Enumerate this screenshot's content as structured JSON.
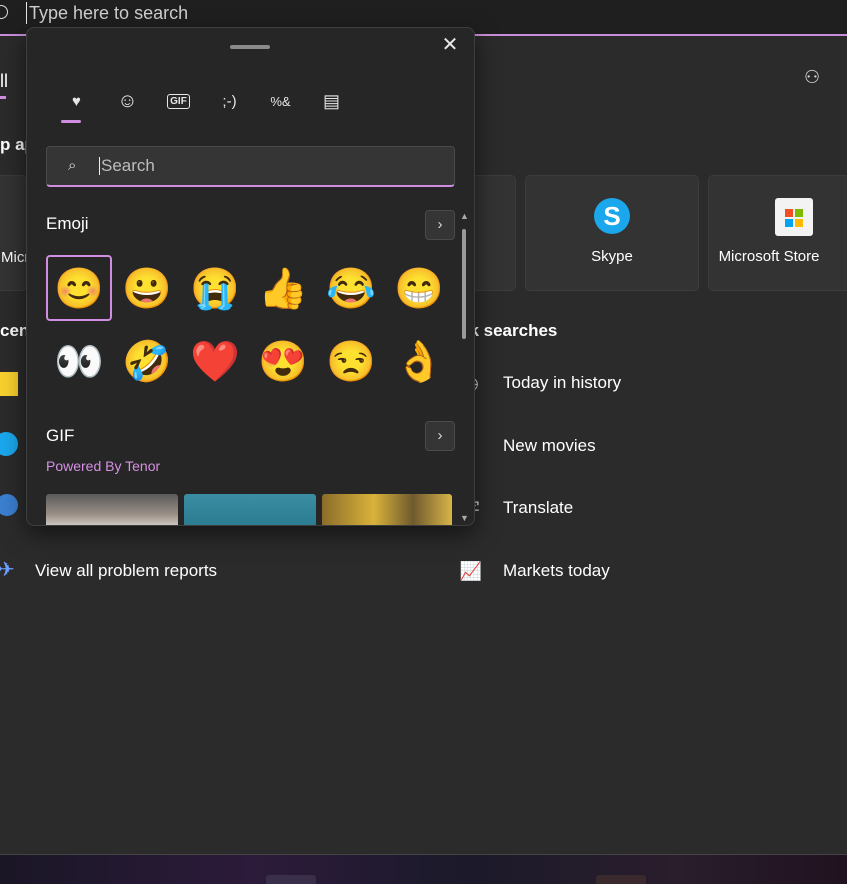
{
  "search_bar": {
    "placeholder": "Type here to search"
  },
  "background": {
    "left_fragments": [
      "ll",
      "p ap",
      "Micr",
      "cent"
    ],
    "tiles": [
      {
        "label": "Skype",
        "icon": "skype-icon"
      },
      {
        "label": "Microsoft Store",
        "icon": "microsoft-store-icon"
      }
    ],
    "quick_searches": {
      "title": "ck searches",
      "items": [
        {
          "label": "Today in history",
          "icon": "clock-icon"
        },
        {
          "label": "New movies",
          "icon": "movie-icon"
        },
        {
          "label": "Translate",
          "icon": "translate-icon"
        },
        {
          "label": "Markets today",
          "icon": "chart-up-icon"
        }
      ]
    },
    "view_all_problem_reports": "View all problem reports"
  },
  "emoji_panel": {
    "tabs": [
      {
        "icon": "favorites-heart-icon",
        "glyph": "♥",
        "active": true
      },
      {
        "icon": "emoji-smiley-icon",
        "glyph": "☺",
        "active": false
      },
      {
        "icon": "gif-icon",
        "glyph": "GIF",
        "active": false
      },
      {
        "icon": "kaomoji-icon",
        "glyph": ";-)",
        "active": false
      },
      {
        "icon": "symbols-icon",
        "glyph": "%&",
        "active": false
      },
      {
        "icon": "clipboard-icon",
        "glyph": "▤",
        "active": false
      }
    ],
    "search_placeholder": "Search",
    "emoji_section_title": "Emoji",
    "emojis": [
      "😊",
      "😀",
      "😭",
      "👍",
      "😂",
      "😁",
      "👀",
      "🤣",
      "❤️",
      "😍",
      "😒",
      "👌"
    ],
    "gif_section_title": "GIF",
    "powered_by": "Powered By Tenor"
  },
  "colors": {
    "accent": "#d08ee0",
    "panel_bg": "#262626",
    "page_bg": "#2b2b2b"
  }
}
